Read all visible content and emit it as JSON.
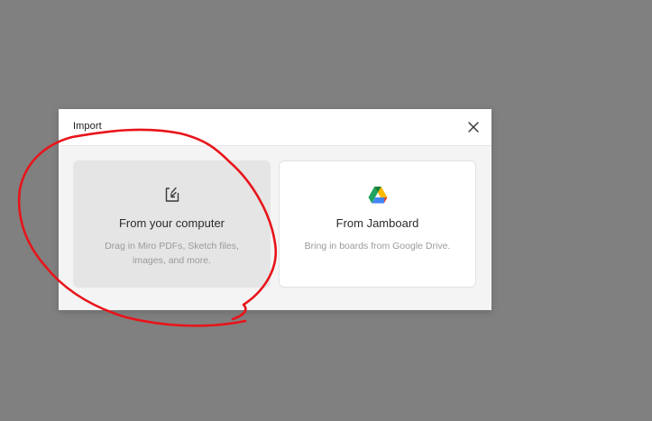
{
  "dialog": {
    "title": "Import",
    "close_icon": "close-icon"
  },
  "options": [
    {
      "title": "From your computer",
      "description": "Drag in Miro PDFs, Sketch files, images, and more.",
      "icon": "upload-file-icon",
      "state": "hovered"
    },
    {
      "title": "From Jamboard",
      "description": "Bring in boards from Google Drive.",
      "icon": "google-drive-icon"
    }
  ],
  "annotation": {
    "type": "hand-drawn circle",
    "color": "#e8141a",
    "target": "From your computer"
  },
  "colors": {
    "backdrop": "#808080",
    "dialog_body": "#f4f4f4",
    "card_hover": "#e5e5e5",
    "drive_green": "#1ea362",
    "drive_blue": "#4285f4",
    "drive_yellow": "#ffba00",
    "drive_red": "#ea4335"
  }
}
